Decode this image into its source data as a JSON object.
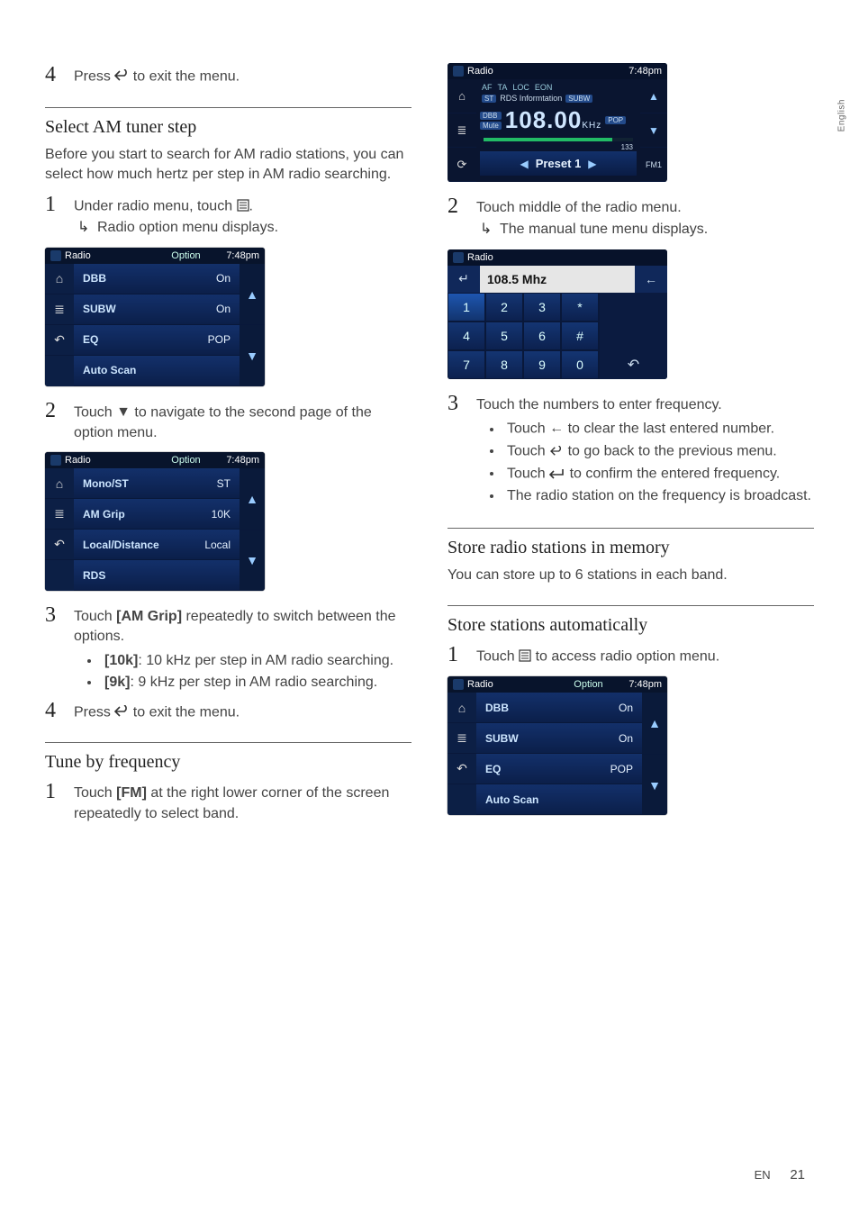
{
  "page": {
    "language_side": "English",
    "footer_lang": "EN",
    "footer_page": "21"
  },
  "icons": {
    "back": "back-icon",
    "menu": "menu-icon",
    "down": "down-triangle-icon",
    "enter": "enter-icon",
    "left": "left-arrow-icon"
  },
  "col1": {
    "step4_top": {
      "pre": "Press ",
      "post": " to exit the menu."
    },
    "sec1": {
      "heading": "Select AM tuner step",
      "intro": "Before you start to search for AM radio stations, you can select how much hertz per step in AM radio searching.",
      "step1": {
        "pre": "Under radio menu, touch ",
        "post": ".",
        "result": "Radio option menu displays."
      },
      "step2": {
        "pre": "Touch ",
        "post": " to navigate to the second page of the option menu."
      },
      "step3": {
        "text_pre": "Touch ",
        "bold": "[AM Grip]",
        "text_post": " repeatedly to switch between the options.",
        "bullets": [
          {
            "label": "[10k]",
            "text": ": 10 kHz per step in AM radio searching."
          },
          {
            "label": "[9k]",
            "text": ": 9 kHz per step in AM radio searching."
          }
        ]
      },
      "step4": {
        "pre": "Press ",
        "post": " to exit the menu."
      }
    },
    "sec2": {
      "heading": "Tune by frequency",
      "step1": {
        "text_pre": "Touch ",
        "bold": "[FM]",
        "text_post": " at the right lower corner of the screen repeatedly to select band."
      }
    },
    "option_shot_a": {
      "header": {
        "app": "Radio",
        "center": "Option",
        "time": "7:48pm"
      },
      "rows": [
        {
          "k": "DBB",
          "v": "On"
        },
        {
          "k": "SUBW",
          "v": "On"
        },
        {
          "k": "EQ",
          "v": "POP"
        },
        {
          "k": "Auto Scan",
          "v": ""
        }
      ]
    },
    "option_shot_b": {
      "header": {
        "app": "Radio",
        "center": "Option",
        "time": "7:48pm"
      },
      "rows": [
        {
          "k": "Mono/ST",
          "v": "ST"
        },
        {
          "k": "AM Grip",
          "v": "10K"
        },
        {
          "k": "Local/Distance",
          "v": "Local"
        },
        {
          "k": "RDS",
          "v": ""
        }
      ]
    }
  },
  "col2": {
    "radio_shot": {
      "header": {
        "app": "Radio",
        "time": "7:48pm"
      },
      "indicators": [
        "AF",
        "TA",
        "LOC",
        "EON"
      ],
      "badges": {
        "st": "ST",
        "rds": "RDS Informtation",
        "subw": "SUBW",
        "dbb": "DBB",
        "mute": "Mute",
        "pop": "POP"
      },
      "freq": "108.00",
      "freq_unit": "KHz",
      "bar_end": "133",
      "preset": "Preset 1",
      "band": "FM1"
    },
    "step2": {
      "text": "Touch middle of the radio menu.",
      "result": "The manual tune menu displays."
    },
    "kp_shot": {
      "header": {
        "app": "Radio"
      },
      "freq": "108.5 Mhz",
      "keys": [
        [
          "1",
          "2",
          "3",
          "*"
        ],
        [
          "4",
          "5",
          "6",
          "#"
        ],
        [
          "7",
          "8",
          "9",
          "0"
        ]
      ]
    },
    "step3": {
      "text": "Touch the numbers to enter frequency.",
      "bullets": [
        {
          "pre": "Touch ",
          "icon": "left",
          "post": " to clear the last entered number."
        },
        {
          "pre": "Touch ",
          "icon": "back",
          "post": " to go back to the previous menu."
        },
        {
          "pre": "Touch ",
          "icon": "enter",
          "post": " to confirm the entered frequency."
        },
        {
          "plain": "The radio station on the frequency is broadcast."
        }
      ]
    },
    "sec3": {
      "heading": "Store radio stations in memory",
      "intro": "You can store up to 6 stations in each band."
    },
    "sec4": {
      "heading": "Store stations automatically",
      "step1": {
        "pre": "Touch ",
        "post": " to access radio option menu."
      }
    },
    "option_shot_c": {
      "header": {
        "app": "Radio",
        "center": "Option",
        "time": "7:48pm"
      },
      "rows": [
        {
          "k": "DBB",
          "v": "On"
        },
        {
          "k": "SUBW",
          "v": "On"
        },
        {
          "k": "EQ",
          "v": "POP"
        },
        {
          "k": "Auto Scan",
          "v": ""
        }
      ]
    }
  }
}
